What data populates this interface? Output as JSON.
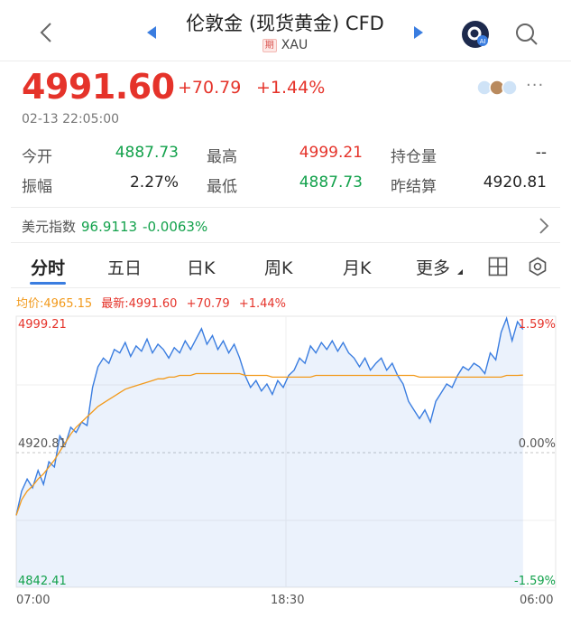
{
  "header": {
    "title": "伦敦金 (现货黄金) CFD",
    "badge": "期",
    "code": "XAU"
  },
  "quote": {
    "price": "4991.60",
    "change": "+70.79",
    "change_pct": "+1.44%",
    "timestamp": "02-13 22:05:00",
    "more": "···"
  },
  "stats": {
    "open_label": "今开",
    "open": "4887.73",
    "high_label": "最高",
    "high": "4999.21",
    "oi_label": "持仓量",
    "oi": "--",
    "amp_label": "振幅",
    "amp": "2.27%",
    "low_label": "最低",
    "low": "4887.73",
    "prev_label": "昨结算",
    "prev": "4920.81"
  },
  "dollar_index": {
    "label": "美元指数",
    "value": "96.9113",
    "change": "-0.0063%"
  },
  "tabs": [
    {
      "label": "分时"
    },
    {
      "label": "五日"
    },
    {
      "label": "日K"
    },
    {
      "label": "周K"
    },
    {
      "label": "月K"
    },
    {
      "label": "更多"
    }
  ],
  "legend": {
    "avg": "均价:4965.15",
    "latest": "最新:4991.60",
    "change": "+70.79",
    "pct": "+1.44%"
  },
  "colors": {
    "up": "#e5332a",
    "down": "#12a14b",
    "accent": "#3a7de0",
    "avg_line": "#f29a1c"
  },
  "chart_data": {
    "type": "line",
    "ylim": [
      4842.41,
      4999.21
    ],
    "base": 4920.81,
    "y_labels_left": [
      "4999.21",
      "4920.81",
      "4842.41"
    ],
    "y_labels_right": [
      "1.59%",
      "0.00%",
      "-1.59%"
    ],
    "x_labels": [
      "07:00",
      "18:30",
      "06:00"
    ],
    "total_points": 100,
    "series": [
      {
        "values": [
          4884,
          4898,
          4905,
          4900,
          4910,
          4902,
          4915,
          4912,
          4930,
          4925,
          4935,
          4932,
          4938,
          4936,
          4958,
          4970,
          4975,
          4972,
          4980,
          4978,
          4984,
          4976,
          4982,
          4979,
          4986,
          4978,
          4983,
          4980,
          4975,
          4981,
          4978,
          4985,
          4980,
          4986,
          4992,
          4983,
          4988,
          4980,
          4985,
          4978,
          4983,
          4975,
          4965,
          4958,
          4962,
          4956,
          4960,
          4954,
          4962,
          4958,
          4965,
          4968,
          4975,
          4972,
          4982,
          4978,
          4984,
          4980,
          4985,
          4979,
          4984,
          4978,
          4975,
          4970,
          4975,
          4968,
          4972,
          4975,
          4968,
          4972,
          4965,
          4960,
          4950,
          4945,
          4940,
          4945,
          4938,
          4950,
          4955,
          4960,
          4958,
          4965,
          4970,
          4968,
          4972,
          4970,
          4966,
          4978,
          4974,
          4990,
          4998,
          4985,
          4996,
          4991.6
        ],
        "avg_values": [
          4884,
          4893,
          4898,
          4901,
          4905,
          4908,
          4912,
          4916,
          4921,
          4926,
          4931,
          4935,
          4938,
          4941,
          4944,
          4947,
          4949,
          4951,
          4953,
          4955,
          4957,
          4958,
          4959,
          4960,
          4961,
          4962,
          4963,
          4963,
          4964,
          4964,
          4965,
          4965,
          4965,
          4966,
          4966,
          4966,
          4966,
          4966,
          4966,
          4966,
          4966,
          4966,
          4965,
          4965,
          4965,
          4965,
          4965,
          4964,
          4964,
          4964,
          4964,
          4964,
          4964,
          4964,
          4964,
          4965,
          4965,
          4965,
          4965,
          4965,
          4965,
          4965,
          4965,
          4965,
          4965,
          4965,
          4965,
          4965,
          4965,
          4965,
          4965,
          4965,
          4965,
          4965,
          4964,
          4964,
          4964,
          4964,
          4964,
          4964,
          4964,
          4964,
          4964,
          4964,
          4964,
          4964,
          4964,
          4964,
          4964,
          4964,
          4965,
          4965,
          4965,
          4965.15
        ]
      }
    ]
  }
}
